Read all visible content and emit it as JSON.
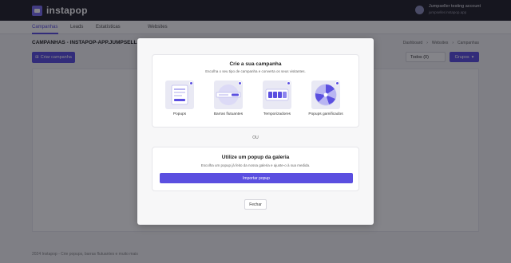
{
  "app": {
    "logo_text": "instapop",
    "account_name": "Jumpseller testing account",
    "account_url": "jumpseller.instapop.app"
  },
  "nav": [
    "Campanhas",
    "Leads",
    "Estatísticas",
    "Websites"
  ],
  "page": {
    "title": "CAMPANHAS - INSTAPOP-APP.JUMPSELLER.COM",
    "breadcrumb": [
      "Dashboard",
      "›",
      "Websites",
      "›",
      "Campanhas"
    ],
    "create_button": "Criar campanha",
    "filter_value": "Todos (0)",
    "group_button": "Grupos",
    "footer": "2024 Instapop - Crie popups, barras flutuantes e muito mais"
  },
  "modal": {
    "campaign_title": "Crie a sua campanha",
    "campaign_subtitle": "Escolha o seu tipo de campanha e converta os seus visitantes.",
    "options": [
      {
        "label": "Popups",
        "icon": "popup-icon"
      },
      {
        "label": "Barras flutuantes",
        "icon": "floating-bar-icon"
      },
      {
        "label": "Temporizadores",
        "icon": "timer-icon"
      },
      {
        "label": "Popups gamificados",
        "icon": "wheel-icon"
      }
    ],
    "or_label": "OU",
    "gallery_title": "Utilize um popup da galeria",
    "gallery_subtitle": "Escolha um popup já feito da nossa galeria e ajuste-o à sua medida.",
    "import_button": "Importar popup",
    "close_button": "Fechar"
  },
  "colors": {
    "accent": "#5b4fe0",
    "topbar": "#23232b"
  }
}
